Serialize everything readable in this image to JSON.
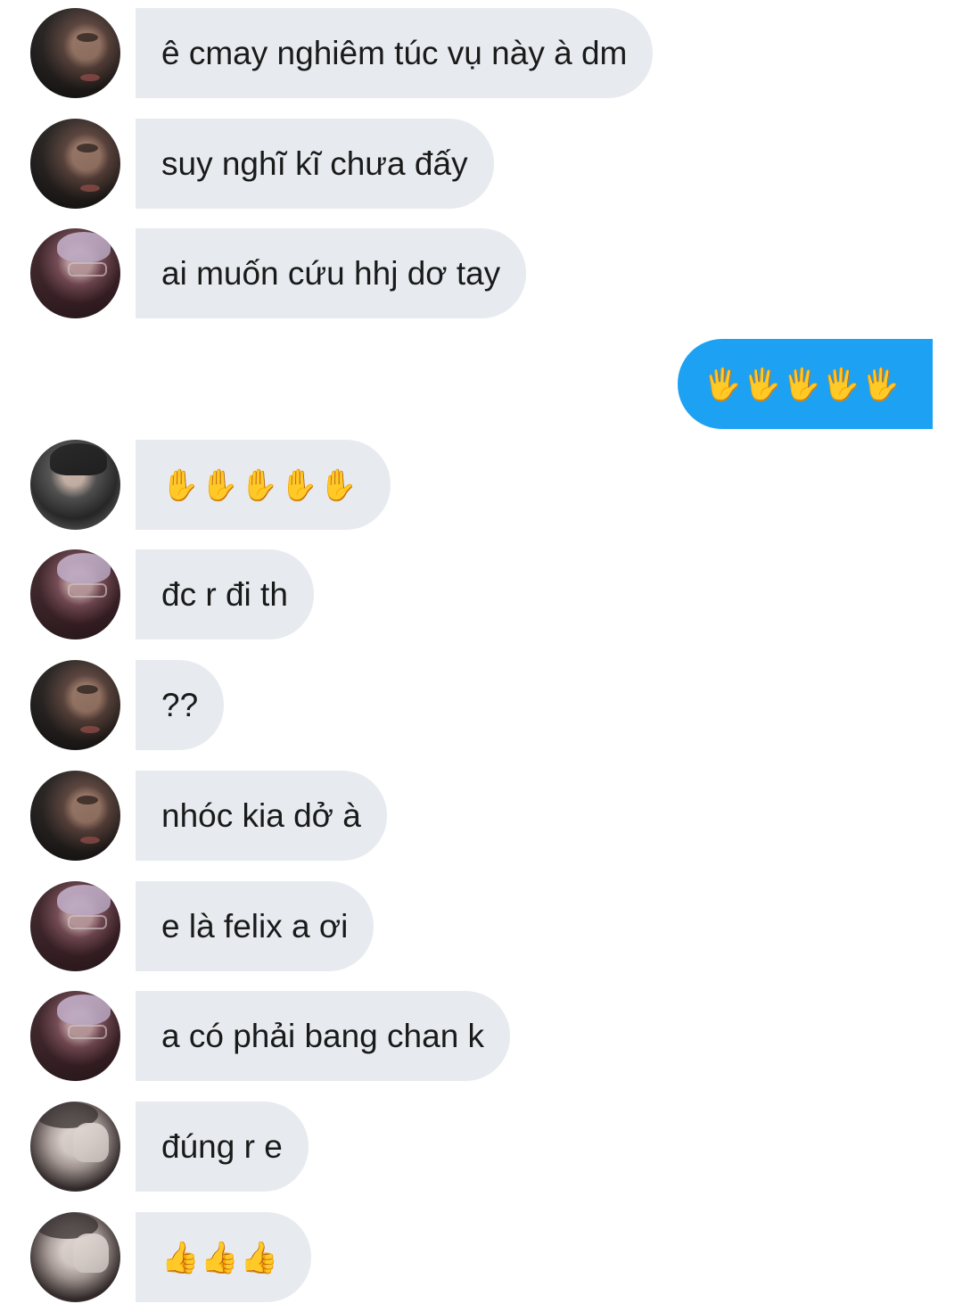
{
  "messages": [
    {
      "avatar": "avatar-dark-hood",
      "text": "ê cmay nghiêm túc vụ này à dm",
      "outgoing": false
    },
    {
      "avatar": "avatar-dark-hood",
      "text": "suy nghĩ kĩ chưa đấy",
      "outgoing": false
    },
    {
      "avatar": "avatar-pink-hair",
      "text": "ai muốn cứu hhj dơ tay",
      "outgoing": false
    },
    {
      "avatar": null,
      "text": "🖐🖐🖐🖐🖐",
      "outgoing": true,
      "emoji": "raised-hand-fingers-splayed"
    },
    {
      "avatar": "avatar-black-hair",
      "text": "✋✋✋✋✋",
      "outgoing": false,
      "emoji": "raised-hand"
    },
    {
      "avatar": "avatar-pink-hair",
      "text": "đc r đi th",
      "outgoing": false
    },
    {
      "avatar": "avatar-dark-hood",
      "text": "??",
      "outgoing": false
    },
    {
      "avatar": "avatar-dark-hood",
      "text": "nhóc kia dở à",
      "outgoing": false
    },
    {
      "avatar": "avatar-pink-hair",
      "text": "e là felix a ơi",
      "outgoing": false
    },
    {
      "avatar": "avatar-pink-hair",
      "text": "a có phải bang chan k",
      "outgoing": false
    },
    {
      "avatar": "avatar-peace-sign",
      "text": "đúng r e",
      "outgoing": false
    },
    {
      "avatar": "avatar-peace-sign",
      "text": "👍👍👍",
      "outgoing": false,
      "emoji": "thumbs-up"
    }
  ],
  "colors": {
    "incoming_bubble": "#e7ebef",
    "outgoing_bubble": "#1da1f2",
    "text": "#1a1a1a",
    "emoji_yellow": "#f5b21b"
  }
}
